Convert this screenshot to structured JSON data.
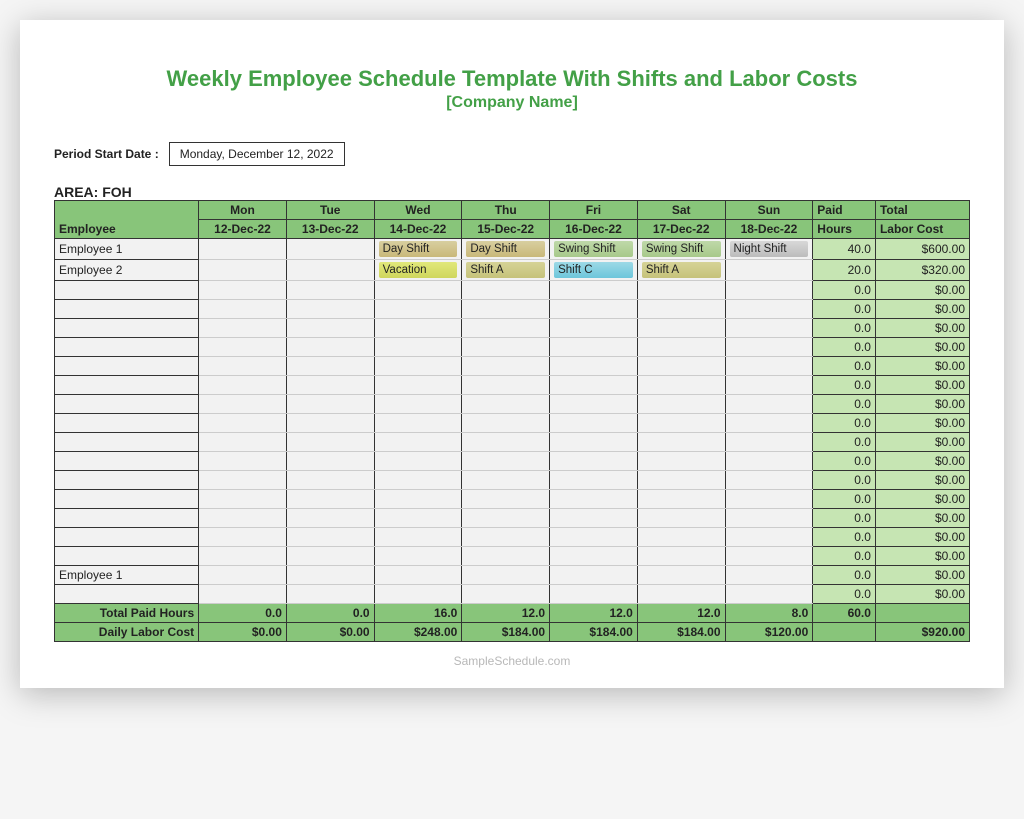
{
  "title": "Weekly Employee Schedule Template With Shifts and Labor Costs",
  "subtitle": "[Company Name]",
  "period_label": "Period Start Date :",
  "period_value": "Monday, December 12, 2022",
  "area_label": "AREA: FOH",
  "headers": {
    "employee": "Employee",
    "days": [
      {
        "dow": "Mon",
        "date": "12-Dec-22"
      },
      {
        "dow": "Tue",
        "date": "13-Dec-22"
      },
      {
        "dow": "Wed",
        "date": "14-Dec-22"
      },
      {
        "dow": "Thu",
        "date": "15-Dec-22"
      },
      {
        "dow": "Fri",
        "date": "16-Dec-22"
      },
      {
        "dow": "Sat",
        "date": "17-Dec-22"
      },
      {
        "dow": "Sun",
        "date": "18-Dec-22"
      }
    ],
    "paid1": "Paid",
    "paid2": "Hours",
    "cost1": "Total",
    "cost2": "Labor Cost"
  },
  "rows": [
    {
      "emp": "Employee 1",
      "cells": [
        "",
        "",
        {
          "t": "Day Shift",
          "c": "shift-day"
        },
        {
          "t": "Day Shift",
          "c": "shift-day"
        },
        {
          "t": "Swing Shift",
          "c": "shift-swing"
        },
        {
          "t": "Swing Shift",
          "c": "shift-swing"
        },
        {
          "t": "Night Shift",
          "c": "shift-night"
        }
      ],
      "hours": "40.0",
      "cost": "$600.00"
    },
    {
      "emp": "Employee 2",
      "cells": [
        "",
        "",
        {
          "t": "Vacation",
          "c": "shift-vac"
        },
        {
          "t": "Shift A",
          "c": "shift-a"
        },
        {
          "t": "Shift C",
          "c": "shift-c"
        },
        {
          "t": "Shift A",
          "c": "shift-a"
        },
        ""
      ],
      "hours": "20.0",
      "cost": "$320.00"
    },
    {
      "emp": "",
      "cells": [
        "",
        "",
        "",
        "",
        "",
        "",
        ""
      ],
      "hours": "0.0",
      "cost": "$0.00"
    },
    {
      "emp": "",
      "cells": [
        "",
        "",
        "",
        "",
        "",
        "",
        ""
      ],
      "hours": "0.0",
      "cost": "$0.00"
    },
    {
      "emp": "",
      "cells": [
        "",
        "",
        "",
        "",
        "",
        "",
        ""
      ],
      "hours": "0.0",
      "cost": "$0.00"
    },
    {
      "emp": "",
      "cells": [
        "",
        "",
        "",
        "",
        "",
        "",
        ""
      ],
      "hours": "0.0",
      "cost": "$0.00"
    },
    {
      "emp": "",
      "cells": [
        "",
        "",
        "",
        "",
        "",
        "",
        ""
      ],
      "hours": "0.0",
      "cost": "$0.00"
    },
    {
      "emp": "",
      "cells": [
        "",
        "",
        "",
        "",
        "",
        "",
        ""
      ],
      "hours": "0.0",
      "cost": "$0.00"
    },
    {
      "emp": "",
      "cells": [
        "",
        "",
        "",
        "",
        "",
        "",
        ""
      ],
      "hours": "0.0",
      "cost": "$0.00"
    },
    {
      "emp": "",
      "cells": [
        "",
        "",
        "",
        "",
        "",
        "",
        ""
      ],
      "hours": "0.0",
      "cost": "$0.00"
    },
    {
      "emp": "",
      "cells": [
        "",
        "",
        "",
        "",
        "",
        "",
        ""
      ],
      "hours": "0.0",
      "cost": "$0.00"
    },
    {
      "emp": "",
      "cells": [
        "",
        "",
        "",
        "",
        "",
        "",
        ""
      ],
      "hours": "0.0",
      "cost": "$0.00"
    },
    {
      "emp": "",
      "cells": [
        "",
        "",
        "",
        "",
        "",
        "",
        ""
      ],
      "hours": "0.0",
      "cost": "$0.00"
    },
    {
      "emp": "",
      "cells": [
        "",
        "",
        "",
        "",
        "",
        "",
        ""
      ],
      "hours": "0.0",
      "cost": "$0.00"
    },
    {
      "emp": "",
      "cells": [
        "",
        "",
        "",
        "",
        "",
        "",
        ""
      ],
      "hours": "0.0",
      "cost": "$0.00"
    },
    {
      "emp": "",
      "cells": [
        "",
        "",
        "",
        "",
        "",
        "",
        ""
      ],
      "hours": "0.0",
      "cost": "$0.00"
    },
    {
      "emp": "",
      "cells": [
        "",
        "",
        "",
        "",
        "",
        "",
        ""
      ],
      "hours": "0.0",
      "cost": "$0.00"
    },
    {
      "emp": "Employee 1",
      "cells": [
        "",
        "",
        "",
        "",
        "",
        "",
        ""
      ],
      "hours": "0.0",
      "cost": "$0.00"
    },
    {
      "emp": "",
      "cells": [
        "",
        "",
        "",
        "",
        "",
        "",
        ""
      ],
      "hours": "0.0",
      "cost": "$0.00"
    }
  ],
  "footer": {
    "paid_label": "Total Paid Hours",
    "paid_vals": [
      "0.0",
      "0.0",
      "16.0",
      "12.0",
      "12.0",
      "12.0",
      "8.0"
    ],
    "paid_total": "60.0",
    "cost_label": "Daily Labor Cost",
    "cost_vals": [
      "$0.00",
      "$0.00",
      "$248.00",
      "$184.00",
      "$184.00",
      "$184.00",
      "$120.00"
    ],
    "grand_total": "$920.00"
  },
  "watermark": "SampleSchedule.com"
}
